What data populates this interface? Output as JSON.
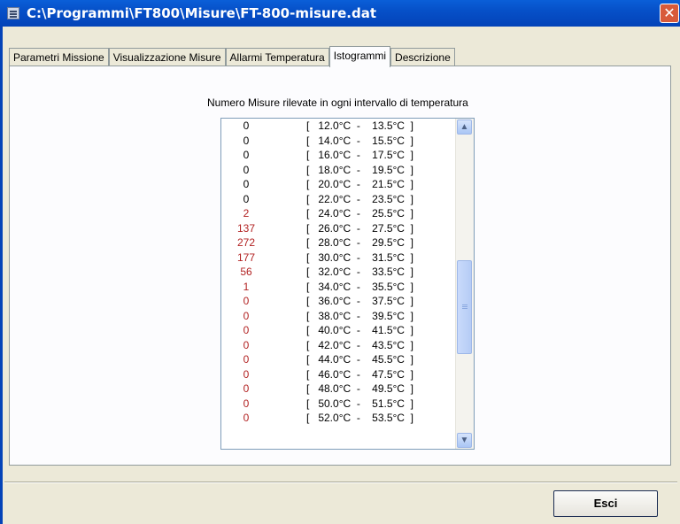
{
  "window": {
    "title": "C:\\Programmi\\FT800\\Misure\\FT-800-misure.dat",
    "close_glyph": "✕"
  },
  "tabs": [
    {
      "label": "Parametri Missione"
    },
    {
      "label": "Visualizzazione Misure"
    },
    {
      "label": "Allarmi Temperatura"
    },
    {
      "label": "Istogrammi",
      "active": true
    },
    {
      "label": "Descrizione"
    }
  ],
  "histogram": {
    "caption": "Numero Misure rilevate in ogni intervallo di temperatura",
    "rows": [
      {
        "count": "0",
        "range": "[   12.0°C  -    13.5°C  ]",
        "color": "black"
      },
      {
        "count": "0",
        "range": "[   14.0°C  -    15.5°C  ]",
        "color": "black"
      },
      {
        "count": "0",
        "range": "[   16.0°C  -    17.5°C  ]",
        "color": "black"
      },
      {
        "count": "0",
        "range": "[   18.0°C  -    19.5°C  ]",
        "color": "black"
      },
      {
        "count": "0",
        "range": "[   20.0°C  -    21.5°C  ]",
        "color": "black"
      },
      {
        "count": "0",
        "range": "[   22.0°C  -    23.5°C  ]",
        "color": "black"
      },
      {
        "count": "2",
        "range": "[   24.0°C  -    25.5°C  ]",
        "color": "red"
      },
      {
        "count": "137",
        "range": "[   26.0°C  -    27.5°C  ]",
        "color": "red"
      },
      {
        "count": "272",
        "range": "[   28.0°C  -    29.5°C  ]",
        "color": "red"
      },
      {
        "count": "177",
        "range": "[   30.0°C  -    31.5°C  ]",
        "color": "red"
      },
      {
        "count": "56",
        "range": "[   32.0°C  -    33.5°C  ]",
        "color": "red"
      },
      {
        "count": "1",
        "range": "[   34.0°C  -    35.5°C  ]",
        "color": "red"
      },
      {
        "count": "0",
        "range": "[   36.0°C  -    37.5°C  ]",
        "color": "red"
      },
      {
        "count": "0",
        "range": "[   38.0°C  -    39.5°C  ]",
        "color": "red"
      },
      {
        "count": "0",
        "range": "[   40.0°C  -    41.5°C  ]",
        "color": "red"
      },
      {
        "count": "0",
        "range": "[   42.0°C  -    43.5°C  ]",
        "color": "red"
      },
      {
        "count": "0",
        "range": "[   44.0°C  -    45.5°C  ]",
        "color": "red"
      },
      {
        "count": "0",
        "range": "[   46.0°C  -    47.5°C  ]",
        "color": "red"
      },
      {
        "count": "0",
        "range": "[   48.0°C  -    49.5°C  ]",
        "color": "red"
      },
      {
        "count": "0",
        "range": "[   50.0°C  -    51.5°C  ]",
        "color": "red"
      },
      {
        "count": "0",
        "range": "[   52.0°C  -    53.5°C  ]",
        "color": "red"
      }
    ],
    "scrollbar": {
      "up_glyph": "▲",
      "down_glyph": "▼"
    }
  },
  "footer": {
    "esci_label": "Esci"
  },
  "colors": {
    "title_bar": "#0650c8",
    "count_red": "#b22222",
    "panel_bg": "#fcfcfe",
    "window_bg": "#ece9d8"
  }
}
